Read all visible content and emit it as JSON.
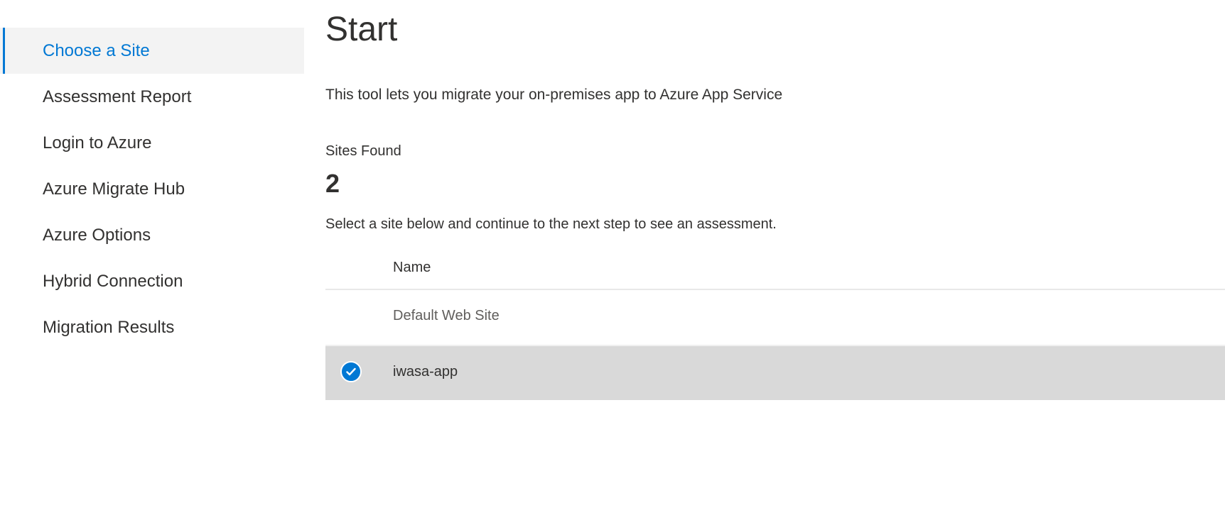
{
  "sidebar": {
    "items": [
      {
        "label": "Choose a Site",
        "active": true
      },
      {
        "label": "Assessment Report"
      },
      {
        "label": "Login to Azure"
      },
      {
        "label": "Azure Migrate Hub"
      },
      {
        "label": "Azure Options"
      },
      {
        "label": "Hybrid Connection"
      },
      {
        "label": "Migration Results"
      }
    ]
  },
  "main": {
    "title": "Start",
    "description": "This tool lets you migrate your on-premises app to Azure App Service",
    "sites_found_label": "Sites Found",
    "sites_found_count": "2",
    "instruction": "Select a site below and continue to the next step to see an assessment.",
    "table": {
      "header": "Name",
      "rows": [
        {
          "name": "Default Web Site",
          "selected": false
        },
        {
          "name": "iwasa-app",
          "selected": true
        }
      ]
    }
  },
  "colors": {
    "accent": "#0078d4",
    "selected_row": "#d9d9d9",
    "active_nav_bg": "#f3f3f3"
  }
}
